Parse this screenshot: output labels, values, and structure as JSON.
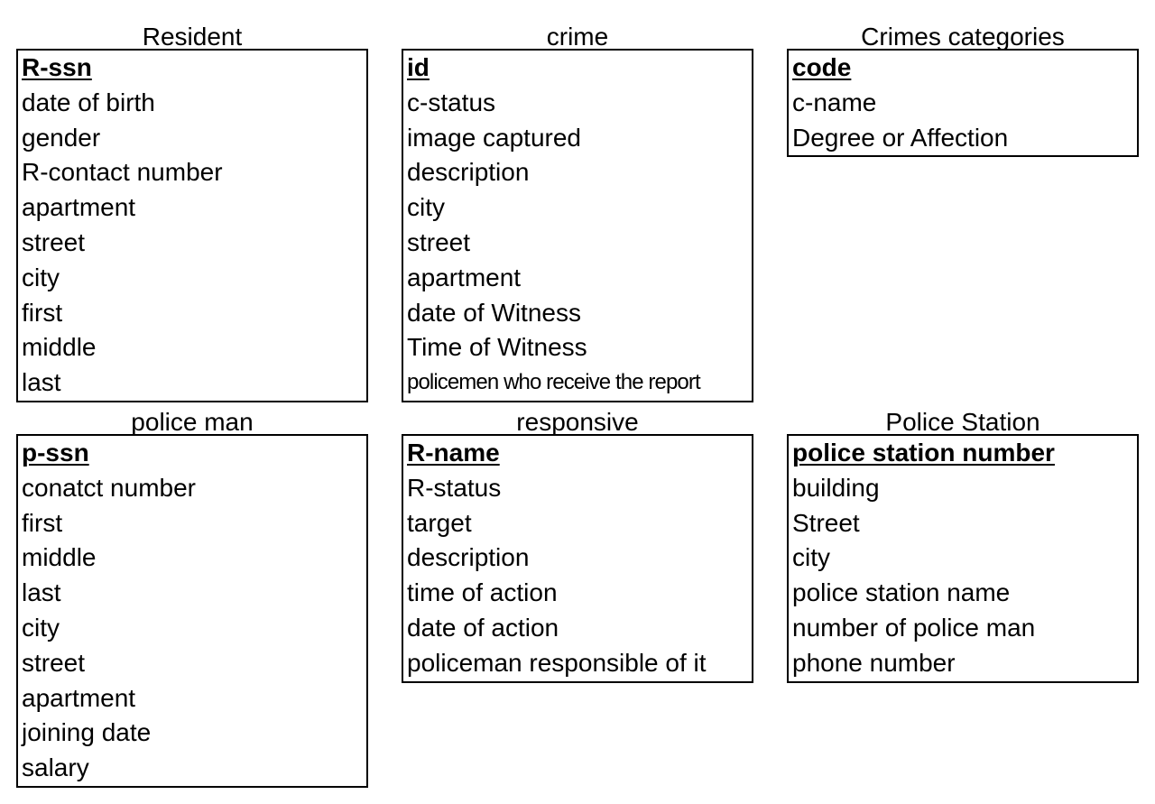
{
  "entities": {
    "resident": {
      "title": "Resident",
      "attributes": [
        "R-ssn",
        "date of birth",
        "gender",
        "R-contact number",
        "apartment",
        "street",
        "city",
        "first",
        "middle",
        "last"
      ]
    },
    "crime": {
      "title": "crime",
      "attributes": [
        "id",
        "c-status",
        "image captured",
        "description",
        "city",
        "street",
        "apartment",
        "date of Witness",
        "Time of Witness",
        "policemen who receive the report"
      ]
    },
    "crime_categories": {
      "title": "Crimes categories",
      "attributes": [
        "code",
        "c-name",
        "Degree or Affection"
      ]
    },
    "police_man": {
      "title": "police man",
      "attributes": [
        "p-ssn",
        "conatct number",
        "first",
        "middle",
        "last",
        "city",
        "street",
        "apartment",
        "joining date",
        "salary"
      ]
    },
    "responsive": {
      "title": "responsive",
      "attributes": [
        "R-name",
        "R-status",
        "target",
        "description",
        "time of action",
        "date of action",
        "policeman responsible of it"
      ]
    },
    "police_station": {
      "title": "Police Station",
      "attributes": [
        "police station number",
        "building",
        "Street",
        "city",
        "police station name",
        "number of police man",
        "phone number"
      ]
    }
  }
}
